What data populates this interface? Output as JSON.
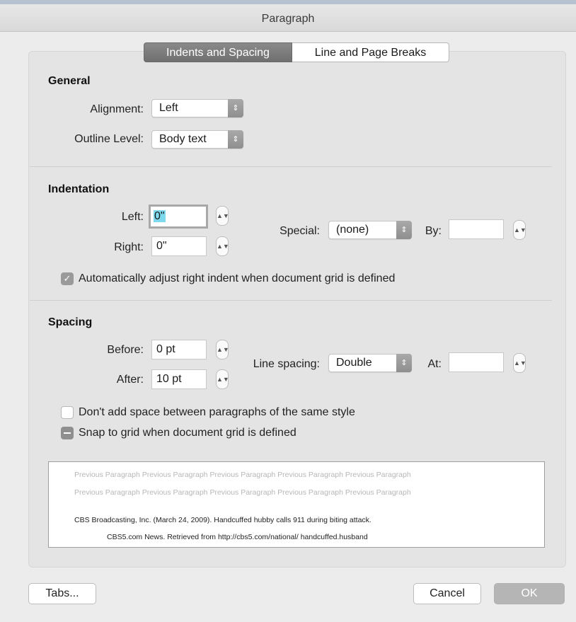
{
  "window": {
    "title": "Paragraph"
  },
  "tabs": [
    {
      "label": "Indents and Spacing",
      "active": true
    },
    {
      "label": "Line and Page Breaks",
      "active": false
    }
  ],
  "general": {
    "heading": "General",
    "alignment_label": "Alignment:",
    "alignment_value": "Left",
    "outline_label": "Outline Level:",
    "outline_value": "Body text"
  },
  "indentation": {
    "heading": "Indentation",
    "left_label": "Left:",
    "left_value": "0\"",
    "right_label": "Right:",
    "right_value": "0\"",
    "special_label": "Special:",
    "special_value": "(none)",
    "by_label": "By:",
    "by_value": "",
    "auto_adjust_label": "Automatically adjust right indent when document grid is defined",
    "auto_adjust_checked": true
  },
  "spacing": {
    "heading": "Spacing",
    "before_label": "Before:",
    "before_value": "0 pt",
    "after_label": "After:",
    "after_value": "10 pt",
    "line_spacing_label": "Line spacing:",
    "line_spacing_value": "Double",
    "at_label": "At:",
    "at_value": "",
    "dont_add_space_label": "Don't add space between paragraphs of the same style",
    "snap_to_grid_label": "Snap to grid when document grid is defined"
  },
  "preview": {
    "previous_line_1": "Previous Paragraph Previous Paragraph Previous Paragraph Previous Paragraph Previous Paragraph",
    "previous_line_2": "Previous Paragraph Previous Paragraph Previous Paragraph Previous Paragraph Previous Paragraph",
    "sample_line_1": "CBS Broadcasting, Inc.  (March 24, 2009).  Handcuffed hubby calls 911 during biting attack.",
    "sample_line_2": "CBS5.com News.  Retrieved from http://cbs5.com/national/ handcuffed.husband"
  },
  "buttons": {
    "tabs": "Tabs...",
    "cancel": "Cancel",
    "ok": "OK"
  },
  "colors": {
    "selection_highlight": "#7fd9ee",
    "default_button": "#b5b5b5",
    "active_tab": "#7d7d7d"
  }
}
